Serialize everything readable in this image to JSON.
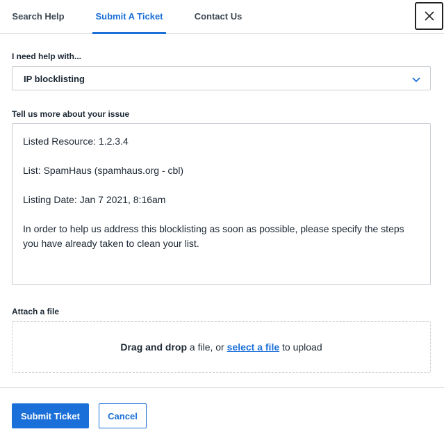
{
  "tabs": [
    {
      "label": "Search Help",
      "active": false
    },
    {
      "label": "Submit A Ticket",
      "active": true
    },
    {
      "label": "Contact Us",
      "active": false
    }
  ],
  "close_icon": "close-icon",
  "form": {
    "topic_label": "I need help with...",
    "topic_value": "IP blocklisting",
    "details_label": "Tell us more about your issue",
    "details_lines": [
      "Listed Resource: 1.2.3.4",
      "List: SpamHaus (spamhaus.org - cbl)",
      "Listing Date: Jan 7 2021, 8:16am",
      "In order to help us address this blocklisting as soon as possible, please specify the steps you have already taken to clean your list."
    ],
    "attach_label": "Attach a file",
    "dropzone": {
      "bold": "Drag and drop",
      "middle": " a file, or ",
      "link": "select a file",
      "end": " to upload"
    }
  },
  "actions": {
    "submit_label": "Submit Ticket",
    "cancel_label": "Cancel"
  },
  "colors": {
    "accent": "#1a6fd8",
    "border": "#c8cdd3",
    "text": "#1b2733"
  }
}
